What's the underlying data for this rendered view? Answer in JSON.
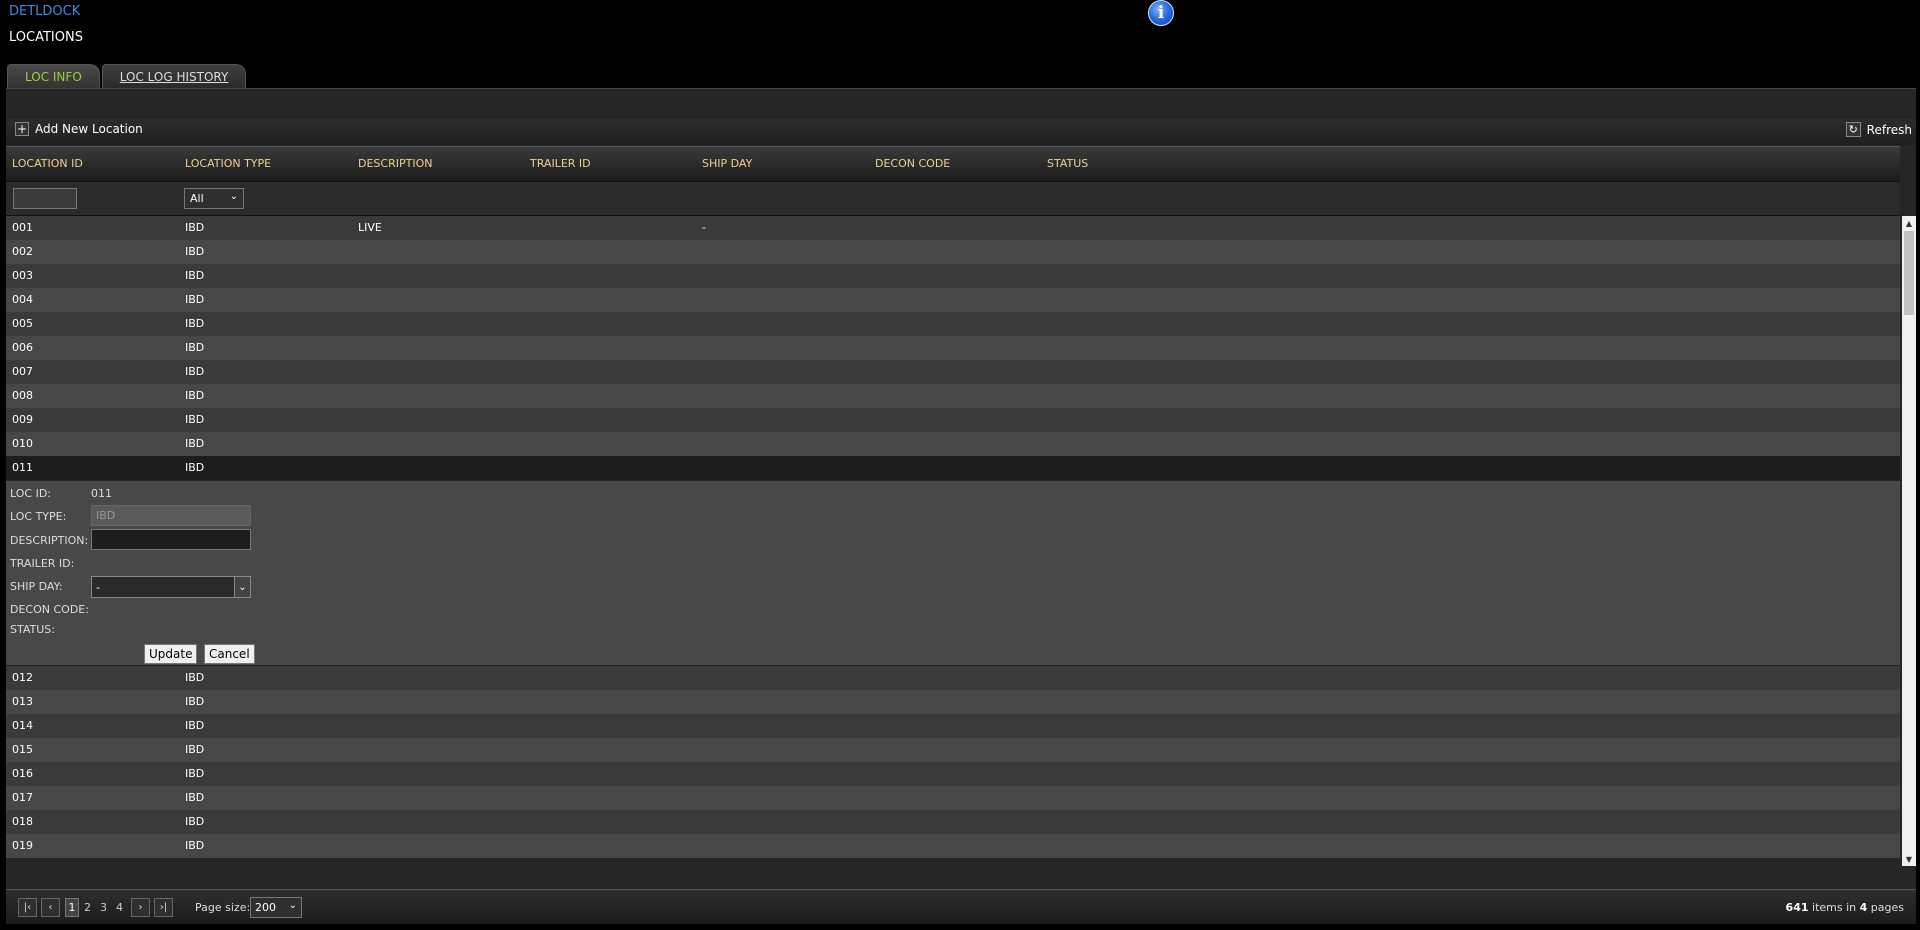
{
  "app": {
    "title": "DETLDOCK",
    "page_title": "LOCATIONS"
  },
  "tabs": [
    {
      "label": "LOC INFO",
      "active": true
    },
    {
      "label": "LOC LOG HISTORY",
      "active": false
    }
  ],
  "toolbar": {
    "add_label": "Add New Location",
    "refresh_label": "Refresh"
  },
  "columns": [
    "LOCATION ID",
    "LOCATION TYPE",
    "DESCRIPTION",
    "TRAILER ID",
    "SHIP DAY",
    "DECON CODE",
    "STATUS"
  ],
  "filters": {
    "location_id_value": "",
    "location_type_value": "All"
  },
  "rows_top": [
    {
      "id": "001",
      "type": "IBD",
      "description": "LIVE",
      "trailer": "",
      "ship_day": "-",
      "decon": "",
      "status": ""
    },
    {
      "id": "002",
      "type": "IBD",
      "description": "",
      "trailer": "",
      "ship_day": "",
      "decon": "",
      "status": ""
    },
    {
      "id": "003",
      "type": "IBD",
      "description": "",
      "trailer": "",
      "ship_day": "",
      "decon": "",
      "status": ""
    },
    {
      "id": "004",
      "type": "IBD",
      "description": "",
      "trailer": "",
      "ship_day": "",
      "decon": "",
      "status": ""
    },
    {
      "id": "005",
      "type": "IBD",
      "description": "",
      "trailer": "",
      "ship_day": "",
      "decon": "",
      "status": ""
    },
    {
      "id": "006",
      "type": "IBD",
      "description": "",
      "trailer": "",
      "ship_day": "",
      "decon": "",
      "status": ""
    },
    {
      "id": "007",
      "type": "IBD",
      "description": "",
      "trailer": "",
      "ship_day": "",
      "decon": "",
      "status": ""
    },
    {
      "id": "008",
      "type": "IBD",
      "description": "",
      "trailer": "",
      "ship_day": "",
      "decon": "",
      "status": ""
    },
    {
      "id": "009",
      "type": "IBD",
      "description": "",
      "trailer": "",
      "ship_day": "",
      "decon": "",
      "status": ""
    },
    {
      "id": "010",
      "type": "IBD",
      "description": "",
      "trailer": "",
      "ship_day": "",
      "decon": "",
      "status": ""
    },
    {
      "id": "011",
      "type": "IBD",
      "description": "",
      "trailer": "",
      "ship_day": "",
      "decon": "",
      "status": ""
    }
  ],
  "editor": {
    "loc_id_label": "LOC ID:",
    "loc_id_value": "011",
    "loc_type_label": "LOC TYPE:",
    "loc_type_value": "IBD",
    "description_label": "DESCRIPTION:",
    "description_value": "",
    "trailer_label": "TRAILER ID:",
    "ship_day_label": "SHIP DAY:",
    "ship_day_value": "-",
    "decon_label": "DECON CODE:",
    "status_label": "STATUS:",
    "update_label": "Update",
    "cancel_label": "Cancel"
  },
  "rows_bottom": [
    {
      "id": "012",
      "type": "IBD"
    },
    {
      "id": "013",
      "type": "IBD"
    },
    {
      "id": "014",
      "type": "IBD"
    },
    {
      "id": "015",
      "type": "IBD"
    },
    {
      "id": "016",
      "type": "IBD"
    },
    {
      "id": "017",
      "type": "IBD"
    },
    {
      "id": "018",
      "type": "IBD"
    },
    {
      "id": "019",
      "type": "IBD"
    }
  ],
  "pager": {
    "pages": [
      "1",
      "2",
      "3",
      "4"
    ],
    "current": "1",
    "page_size_label": "Page size:",
    "page_size": "200",
    "total_items": "641",
    "items_in": "items in",
    "total_pages": "4",
    "pages_word": "pages"
  },
  "colors": {
    "accent_blue": "#3a8de0",
    "active_tab": "#9ad13f",
    "header_text": "#f0d090"
  }
}
